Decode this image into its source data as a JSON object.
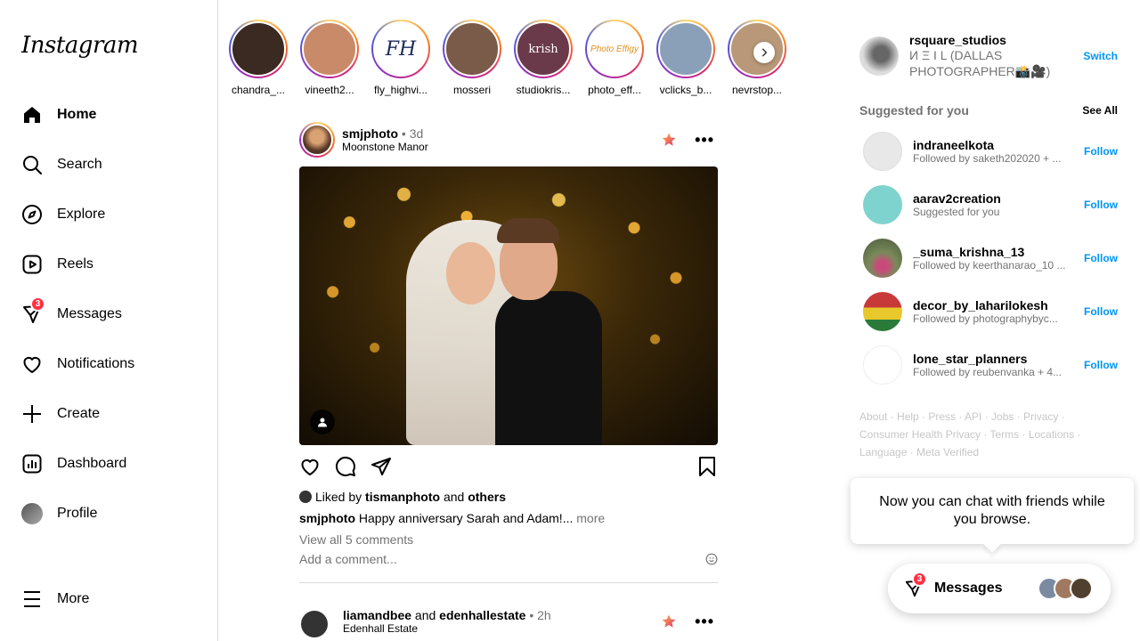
{
  "app": {
    "logo": "Instagram"
  },
  "nav": {
    "items": [
      {
        "id": "home",
        "label": "Home",
        "icon": "home-icon",
        "active": true
      },
      {
        "id": "search",
        "label": "Search",
        "icon": "search-icon"
      },
      {
        "id": "explore",
        "label": "Explore",
        "icon": "compass-icon"
      },
      {
        "id": "reels",
        "label": "Reels",
        "icon": "reels-icon"
      },
      {
        "id": "messages",
        "label": "Messages",
        "icon": "messenger-icon",
        "badge": "3"
      },
      {
        "id": "notifications",
        "label": "Notifications",
        "icon": "heart-icon"
      },
      {
        "id": "create",
        "label": "Create",
        "icon": "plus-icon"
      },
      {
        "id": "dashboard",
        "label": "Dashboard",
        "icon": "dashboard-icon"
      },
      {
        "id": "profile",
        "label": "Profile",
        "icon": "avatar"
      }
    ],
    "more_label": "More"
  },
  "stories": [
    {
      "label": "chandra_...",
      "color": "#3a2a22"
    },
    {
      "label": "vineeth2...",
      "color": "#c98a6a"
    },
    {
      "label": "fly_highvi...",
      "color": "#ffffff"
    },
    {
      "label": "mosseri",
      "color": "#7a5a48"
    },
    {
      "label": "studiokris...",
      "color": "#6a3a4a"
    },
    {
      "label": "photo_eff...",
      "color": "#f2d24a"
    },
    {
      "label": "vclicks_b...",
      "color": "#8aa0b8"
    },
    {
      "label": "nevrstop...",
      "color": "#b89878"
    }
  ],
  "post": {
    "username": "smjphoto",
    "dot": "•",
    "time": "3d",
    "location": "Moonstone Manor",
    "liked_prefix": "Liked by",
    "liked_user": "tismanphoto",
    "liked_and": "and",
    "liked_others": "others",
    "caption_user": "smjphoto",
    "caption_text": "Happy anniversary Sarah and Adam!...",
    "caption_more": "more",
    "view_comments": "View all 5 comments",
    "add_comment_placeholder": "Add a comment..."
  },
  "post2": {
    "user1": "liamandbee",
    "and": "and",
    "user2": "edenhallestate",
    "dot": "•",
    "time": "2h",
    "location": "Edenhall Estate"
  },
  "me": {
    "username": "rsquare_studios",
    "fullname": "И Ξ I L (DALLAS PHOTOGRAPHER📸🎥)",
    "switch_label": "Switch"
  },
  "suggestions": {
    "title": "Suggested for you",
    "see_all": "See All",
    "follow_label": "Follow",
    "items": [
      {
        "username": "indraneelkota",
        "sub": "Followed by saketh202020 + ...",
        "color": "#e8e8e8"
      },
      {
        "username": "aarav2creation",
        "sub": "Suggested for you",
        "color": "#7fd3cf"
      },
      {
        "username": "_suma_krishna_13",
        "sub": "Followed by keerthanarao_10 ...",
        "color": "#7a8a5a"
      },
      {
        "username": "decor_by_laharilokesh",
        "sub": "Followed by photographybyc...",
        "color": "#c83a3a"
      },
      {
        "username": "lone_star_planners",
        "sub": "Followed by reubenvanka + 4...",
        "color": "#ffffff"
      }
    ]
  },
  "footer": {
    "line1": "About · Help · Press · API · Jobs · Privacy ·",
    "line2": "Consumer Health Privacy · Terms · Locations ·",
    "line3": "Language · Meta Verified"
  },
  "chat_tip": {
    "text": "Now you can chat with friends while you browse."
  },
  "msg_pill": {
    "label": "Messages",
    "badge": "3"
  }
}
